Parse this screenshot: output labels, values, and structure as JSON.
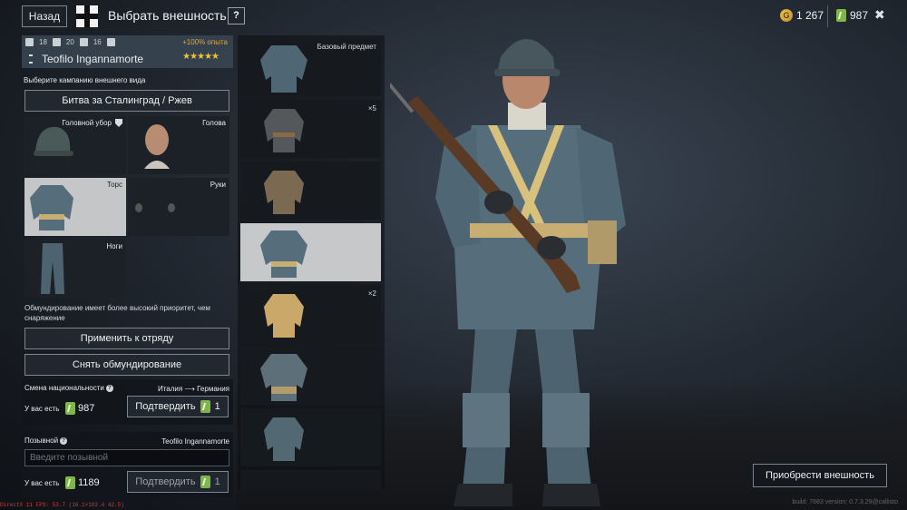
{
  "header": {
    "back_label": "Назад",
    "title": "Выбрать внешность",
    "help_label": "?",
    "silver": "1 267",
    "gold": "987",
    "close_label": "✖"
  },
  "soldier": {
    "stat1": "18",
    "stat2": "20",
    "stat3": "16",
    "bonus": "+100% опыта",
    "name": "Teofilo Ingannamorte",
    "stars": "★★★★★"
  },
  "campaign": {
    "label": "Выберите кампанию внешнего вида",
    "value": "Битва за Сталинград / Ржев"
  },
  "slots": {
    "head_gear": "Головной убор",
    "head": "Голова",
    "torso": "Торс",
    "hands": "Руки",
    "legs": "Ноги"
  },
  "priority_note": "Обмундирование имеет более высокий приоритет, чем снаряжение",
  "buttons": {
    "apply": "Применить к отряду",
    "remove": "Снять обмундирование",
    "buy": "Приобрести внешность"
  },
  "nationality": {
    "title": "Смена национальности",
    "change": "Италия ⟶ Германия",
    "have_label": "У вас есть",
    "have_value": "987",
    "confirm_label": "Подтвердить",
    "cost": "1"
  },
  "callsign": {
    "title": "Позывной",
    "current": "Teofilo Ingannamorte",
    "placeholder": "Введите позывной",
    "have_label": "У вас есть",
    "have_value": "1189",
    "confirm_label": "Подтвердить",
    "cost": "1"
  },
  "items": [
    {
      "tag": "Базовый предмет",
      "selected": false
    },
    {
      "tag": "×5",
      "selected": false
    },
    {
      "tag": "",
      "selected": false
    },
    {
      "tag": "",
      "selected": true
    },
    {
      "tag": "×2",
      "selected": false
    },
    {
      "tag": "",
      "selected": false
    },
    {
      "tag": "",
      "selected": false
    }
  ],
  "debug_text": "DirectX 11  FPS: 53.7  (16.1×102.4 42.5)",
  "build_text": "build: 7683 version: 0.7.3.29@callisto",
  "colors": {
    "accent_gold": "#f0c23a",
    "bonus": "#e0a93a",
    "ticket_green": "#7fb54a",
    "selected_bg": "#c6c8ca"
  }
}
